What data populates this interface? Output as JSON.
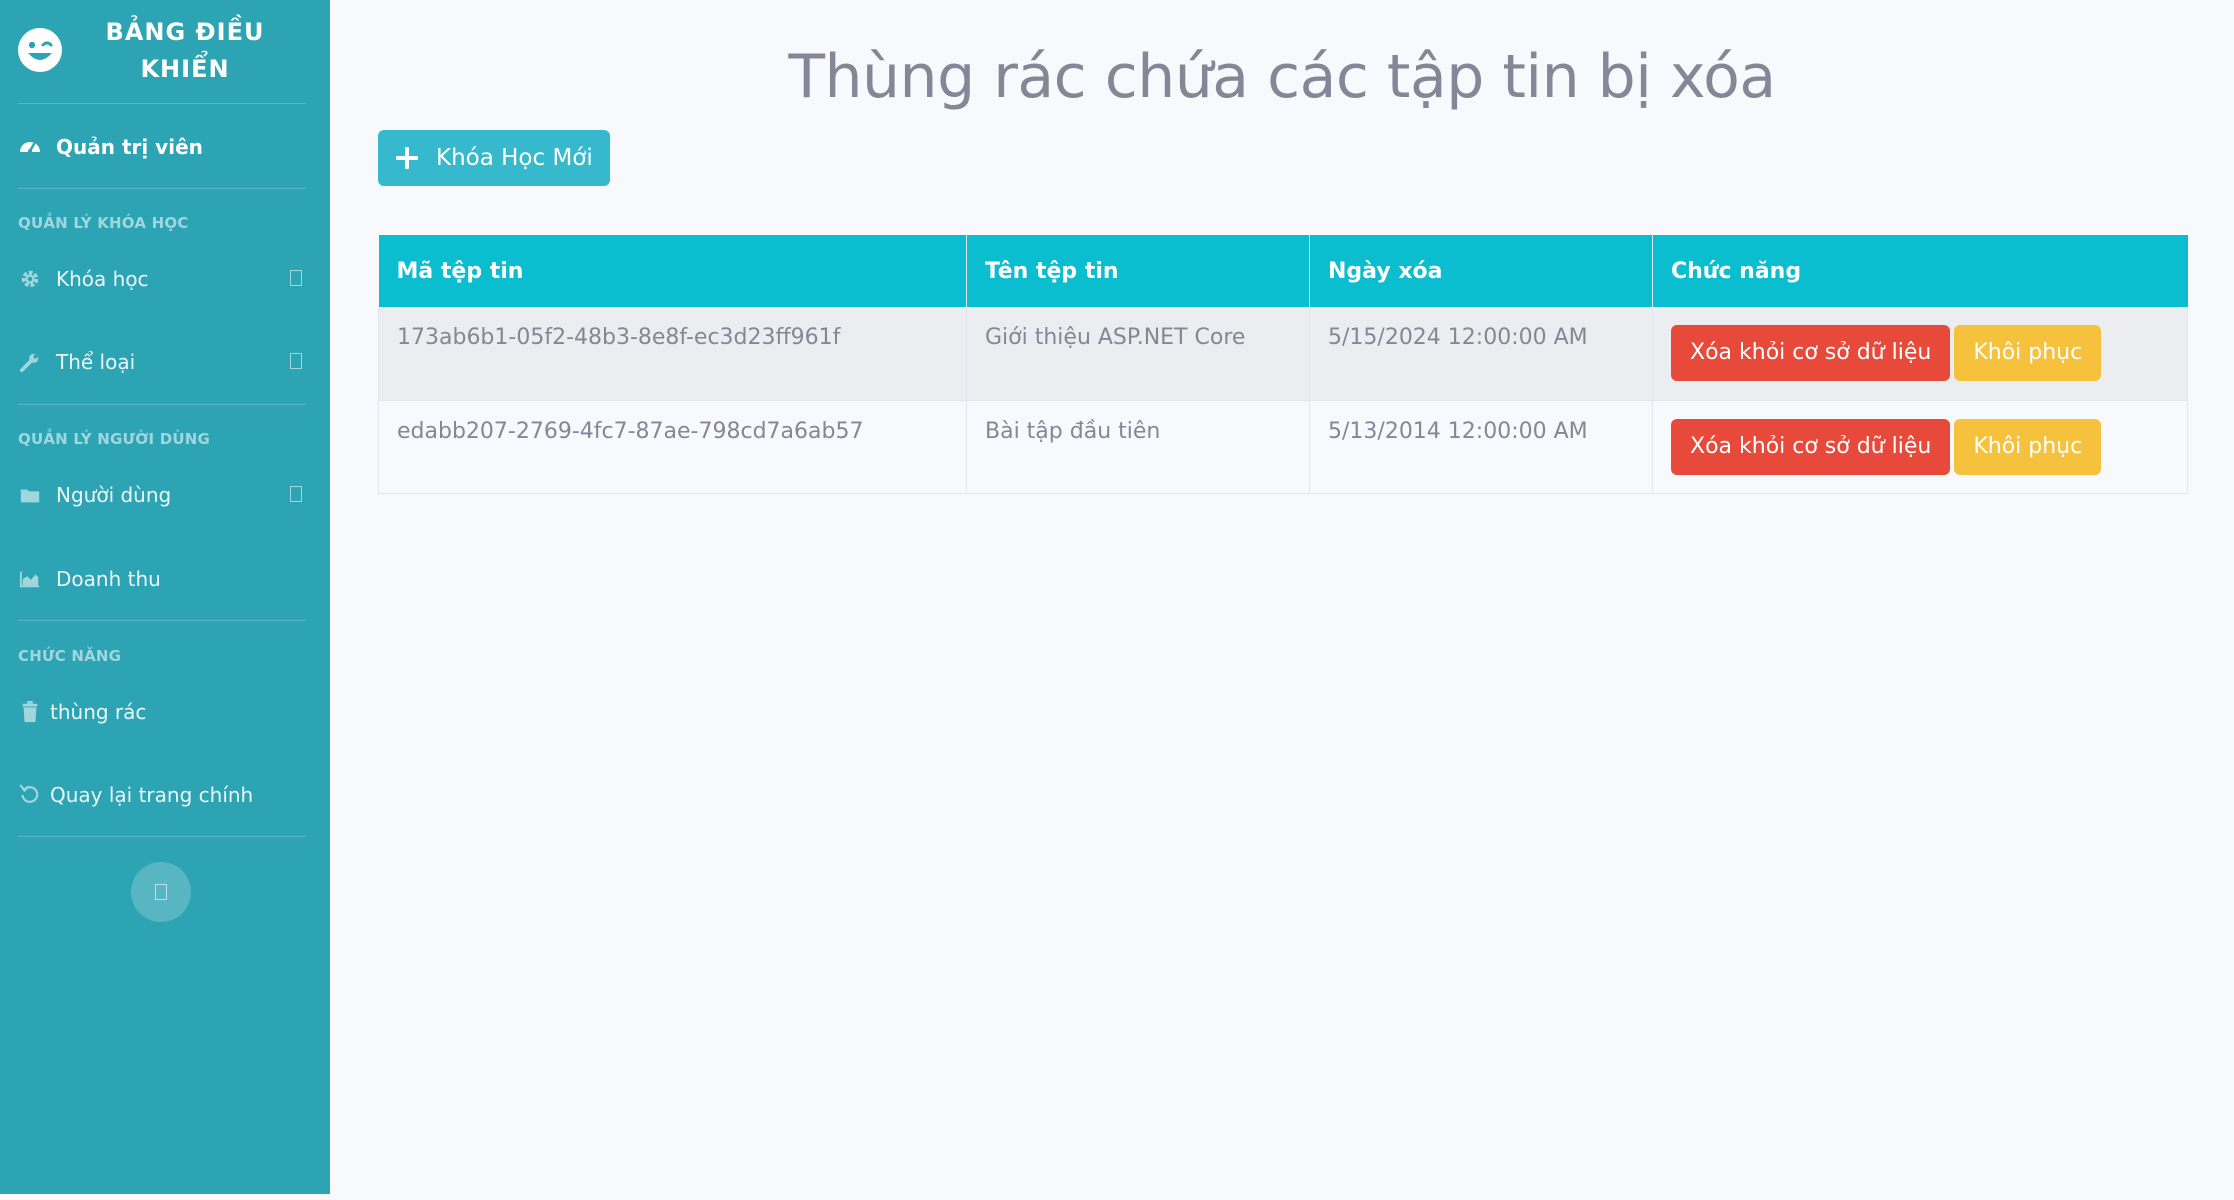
{
  "sidebar": {
    "brand": "BẢNG ĐIỀU KHIỂN",
    "dashboard_label": "Quản trị viên",
    "section_courses": "QUẢN LÝ KHÓA HỌC",
    "courses_label": "Khóa học",
    "categories_label": "Thể loại",
    "section_users": "QUẢN LÝ NGƯỜI DÙNG",
    "users_label": "Người dùng",
    "revenue_label": "Doanh thu",
    "section_functions": "CHỨC NĂNG",
    "trash_label": "thùng rác",
    "back_label": "Quay lại trang chính"
  },
  "main": {
    "title": "Thùng rác chứa các tập tin bị xóa",
    "new_course_label": "Khóa Học Mới",
    "table": {
      "headers": [
        "Mã tệp tin",
        "Tên tệp tin",
        "Ngày xóa",
        "Chức năng"
      ],
      "rows": [
        {
          "id": "173ab6b1-05f2-48b3-8e8f-ec3d23ff961f",
          "name": "Giới thiệu ASP.NET Core",
          "deleted": "5/15/2024 12:00:00 AM"
        },
        {
          "id": "edabb207-2769-4fc7-87ae-798cd7a6ab57",
          "name": "Bài tập đầu tiên",
          "deleted": "5/13/2014 12:00:00 AM"
        }
      ],
      "delete_label": "Xóa khỏi cơ sở dữ liệu",
      "restore_label": "Khôi phục"
    }
  },
  "colors": {
    "sidebar_bg": "#2da4b3",
    "header_bg": "#0abdcf",
    "danger": "#e74a3b",
    "warning": "#f6c23e",
    "info": "#36b9cc"
  }
}
